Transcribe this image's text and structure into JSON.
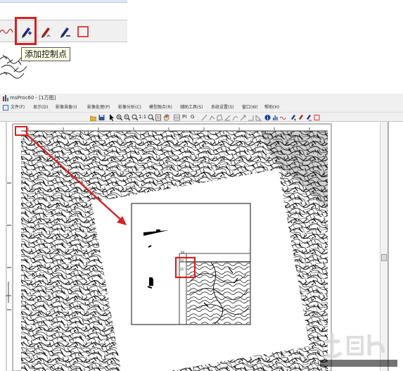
{
  "tooltip": {
    "text": "添加控制点"
  },
  "window": {
    "title": "msProc60 - [1万图]",
    "menu": [
      "文件(F)",
      "显示(D)",
      "影像准备(I)",
      "影像处理(P)",
      "影像分析(C)",
      "模型融合(R)",
      "辅助工具(S)",
      "系统设置(S)",
      "窗口(W)",
      "帮助(H)"
    ],
    "toolbar_text": {
      "zoom_ratio": "1:1",
      "pi": "PI",
      "g": "G"
    }
  },
  "icons": {
    "app": "app-icon",
    "add_control_point": "add-control-point-pen-icon",
    "edit_control_point": "edit-control-point-pen-icon",
    "delete_control_point": "delete-control-point-pen-icon",
    "rectangle": "rectangle-icon"
  },
  "colors": {
    "highlight": "#d62020",
    "tooltip_bg": "#ffffe6",
    "toolbar_bg": "#f0f0f0"
  },
  "inset_map": {
    "labels": [
      "50",
      "50",
      "25"
    ]
  }
}
